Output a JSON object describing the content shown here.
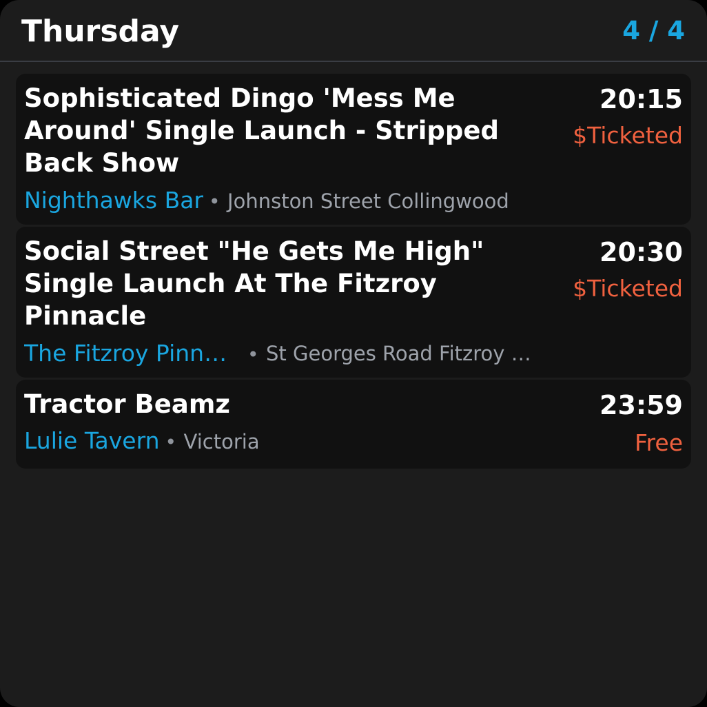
{
  "header": {
    "day": "Thursday",
    "page_indicator": "4 / 4"
  },
  "colors": {
    "background": "#1c1c1c",
    "card": "#111111",
    "accent": "#1aa6e0",
    "price": "#f0613f",
    "muted": "#9ea3ab"
  },
  "events": [
    {
      "title": "Sophisticated Dingo 'Mess Me Around' Single Launch - Stripped Back Show",
      "time": "20:15",
      "price": "$Ticketed",
      "venue": "Nighthawks Bar",
      "separator": "•",
      "address": "Johnston Street Collingwood"
    },
    {
      "title": "Social Street \"He Gets Me High\" Single Launch At The Fitzroy Pinnacle",
      "time": "20:30",
      "price": "$Ticketed",
      "venue": "The Fitzroy Pinnacle",
      "separator": "•",
      "address": "St Georges Road Fitzroy North"
    },
    {
      "title": "Tractor Beamz",
      "time": "23:59",
      "price": "Free",
      "venue": "Lulie Tavern",
      "separator": "•",
      "address": "Victoria"
    }
  ]
}
